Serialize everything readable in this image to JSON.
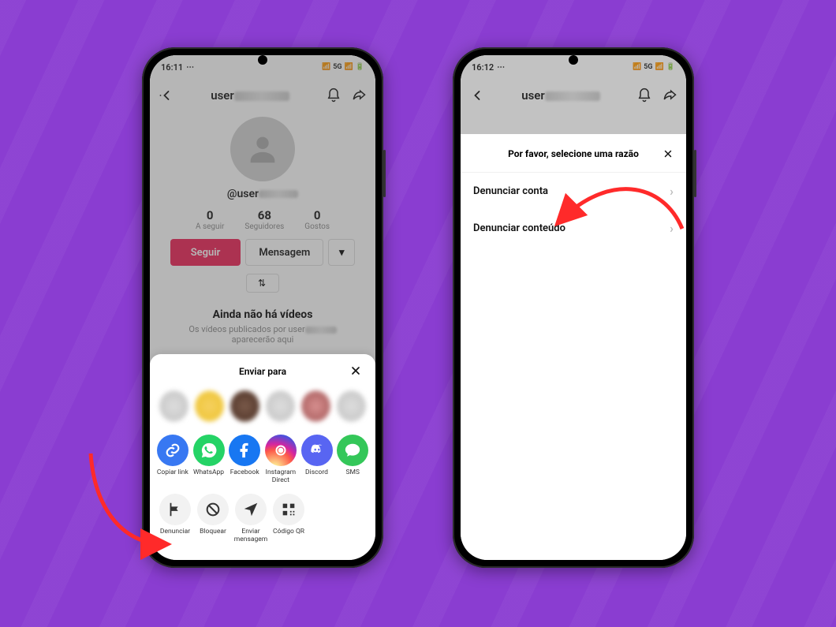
{
  "phone1": {
    "status": {
      "time": "16:11",
      "network": "5G"
    },
    "header": {
      "username_prefix": "user"
    },
    "profile": {
      "handle_prefix": "@user",
      "stats": {
        "following_count": "0",
        "following_label": "A seguir",
        "followers_count": "68",
        "followers_label": "Seguidores",
        "likes_count": "0",
        "likes_label": "Gostos"
      },
      "follow_btn": "Seguir",
      "message_btn": "Mensagem",
      "empty_title": "Ainda não há vídeos",
      "empty_sub_prefix": "Os vídeos publicados por user",
      "empty_sub_suffix": "aparecerão aqui"
    },
    "sheet": {
      "title": "Enviar para",
      "apps": [
        {
          "key": "copy",
          "label": "Copiar link"
        },
        {
          "key": "whatsapp",
          "label": "WhatsApp"
        },
        {
          "key": "facebook",
          "label": "Facebook"
        },
        {
          "key": "instagram",
          "label": "Instagram Direct"
        },
        {
          "key": "discord",
          "label": "Discord"
        },
        {
          "key": "sms",
          "label": "SMS"
        }
      ],
      "actions": [
        {
          "key": "report",
          "label": "Denunciar"
        },
        {
          "key": "block",
          "label": "Bloquear"
        },
        {
          "key": "sendmsg",
          "label": "Enviar mensagem"
        },
        {
          "key": "qr",
          "label": "Código QR"
        }
      ]
    }
  },
  "phone2": {
    "status": {
      "time": "16:12",
      "network": "5G"
    },
    "header": {
      "username_prefix": "user"
    },
    "modal": {
      "title": "Por favor, selecione uma razão",
      "items": [
        {
          "label": "Denunciar conta"
        },
        {
          "label": "Denunciar conteúdo"
        }
      ]
    }
  }
}
